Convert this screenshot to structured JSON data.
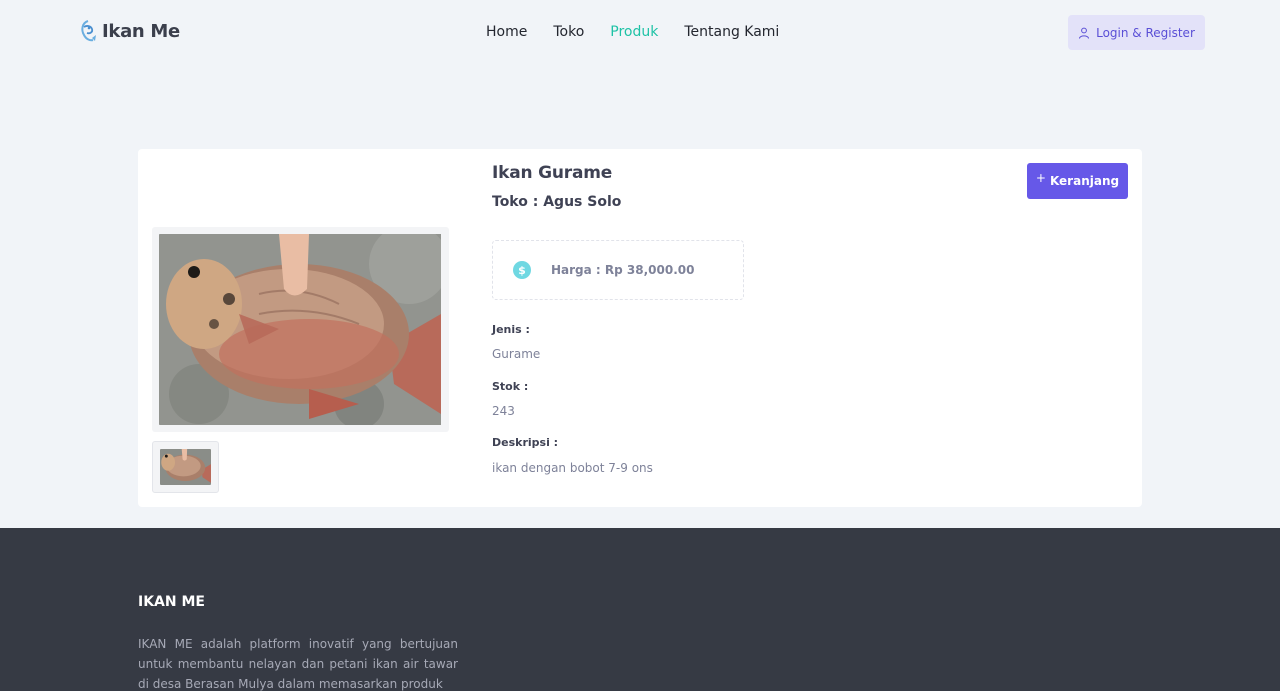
{
  "navbar": {
    "brand": "Ikan Me",
    "menu": [
      {
        "label": "Home",
        "active": false
      },
      {
        "label": "Toko",
        "active": false
      },
      {
        "label": "Produk",
        "active": true
      },
      {
        "label": "Tentang Kami",
        "active": false
      }
    ],
    "login_label": "Login & Register"
  },
  "product": {
    "title": "Ikan Gurame",
    "store": "Toko : Agus Solo",
    "cart_label": "Keranjang",
    "price": "Harga : Rp 38,000.00",
    "fields": [
      {
        "label": "Jenis :",
        "value": "Gurame"
      },
      {
        "label": "Stok :",
        "value": "243"
      },
      {
        "label": "Deskripsi :",
        "value": "ikan dengan bobot 7-9 ons"
      }
    ]
  },
  "footer": {
    "title": "IKAN ME",
    "description": "IKAN ME adalah platform inovatif yang bertujuan untuk membantu nelayan dan petani ikan air tawar di desa Berasan Mulya dalam memasarkan produk"
  },
  "colors": {
    "accent": "#6658e8",
    "active_nav": "#1ec2a6",
    "footer_bg": "#363a44",
    "page_bg": "#f1f4f8"
  },
  "icons": {
    "brand": "fish-logo-icon",
    "login": "user-icon",
    "cart": "plus-icon",
    "price": "dollar-icon"
  }
}
